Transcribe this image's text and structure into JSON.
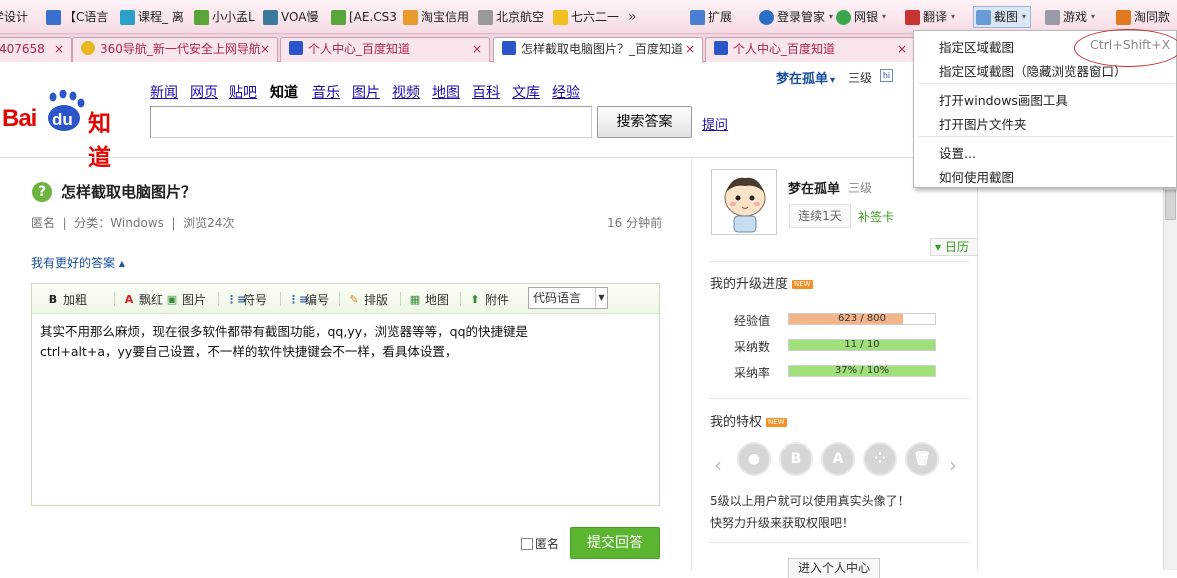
{
  "bookmarks": [
    {
      "label": "学设计",
      "color": "#e0608a"
    },
    {
      "label": "【C语言",
      "color": "#3b6fd0"
    },
    {
      "label": "课程_ 离",
      "color": "#2aa0c8"
    },
    {
      "label": "小小孟L",
      "color": "#5aa53a"
    },
    {
      "label": "VOA慢",
      "color": "#3b7a9a"
    },
    {
      "label": "[AE.CS3",
      "color": "#5aa53a"
    },
    {
      "label": "淘宝信用",
      "color": "#e89b2c"
    },
    {
      "label": "北京航空",
      "color": "#9a9a9a"
    },
    {
      "label": "七六二一",
      "color": "#f0c020"
    }
  ],
  "bookmarks_more": "»",
  "toolbar": {
    "extend": "扩展",
    "login": "登录管家",
    "bank": "网银",
    "translate": "翻译",
    "screenshot": "截图",
    "games": "游戏",
    "taotong": "淘同款"
  },
  "tabs": [
    {
      "label": "407658",
      "active": false
    },
    {
      "label": "360导航_新一代安全上网导航",
      "active": false
    },
    {
      "label": "个人中心_百度知道",
      "active": false
    },
    {
      "label": "怎样截取电脑图片？_百度知道",
      "active": true
    },
    {
      "label": "个人中心_百度知道",
      "active": false
    }
  ],
  "tab_close": "×",
  "header": {
    "logo_bai": "Bai",
    "logo_du": "du",
    "logo_zhidao": "知道",
    "nav": [
      "新闻",
      "网页",
      "贴吧",
      "知道",
      "音乐",
      "图片",
      "视频",
      "地图",
      "百科",
      "文库",
      "经验"
    ],
    "nav_current": "知道",
    "search_button": "搜索答案",
    "ask_link": "提问",
    "user": "梦在孤单",
    "user_caret": "▾",
    "user_level": "三级",
    "hi_icon": "hi"
  },
  "question": {
    "mark": "?",
    "title": "怎样截取电脑图片？",
    "meta": "匿名  |  分类：Windows  |  浏览24次",
    "time": "16 分钟前",
    "better_answer": "我有更好的答案 ▴"
  },
  "editor": {
    "tools": [
      {
        "icon": "B",
        "label": "加粗",
        "name": "bold"
      },
      {
        "icon": "A",
        "label": "飘红",
        "name": "red"
      },
      {
        "icon": "▣",
        "label": "图片",
        "name": "image"
      },
      {
        "icon": "⋮≡",
        "label": "符号",
        "name": "symbol"
      },
      {
        "icon": "⋮≡",
        "label": "编号",
        "name": "numbered"
      },
      {
        "icon": "✎",
        "label": "排版",
        "name": "format"
      },
      {
        "icon": "▦",
        "label": "地图",
        "name": "map"
      },
      {
        "icon": "⬆",
        "label": "附件",
        "name": "attach"
      }
    ],
    "code_language": "代码语言",
    "content": "其实不用那么麻烦，现在很多软件都带有截图功能，qq,yy，浏览器等等，qq的快捷键是\nctrl+alt+a，yy要自己设置，不一样的软件快捷键会不一样，看具体设置，"
  },
  "anonymous_label": "匿名",
  "submit_label": "提交回答",
  "sidebar": {
    "name": "梦在孤单",
    "level": "三级",
    "streak": "连续1天",
    "sign_card": "补签卡",
    "calendar": "▾ 日历",
    "progress_title": "我的升级进度",
    "new_badge": "NEW",
    "progress": [
      {
        "label": "经验值",
        "text": "623 / 800",
        "fraction": 0.779,
        "color": "#f4b48a"
      },
      {
        "label": "采纳数",
        "text": "11 / 10",
        "fraction": 1.0,
        "color": "#9fe07a"
      },
      {
        "label": "采纳率",
        "text": "37% / 10%",
        "fraction": 1.0,
        "color": "#9fe07a"
      }
    ],
    "privilege_title": "我的特权",
    "privileges": [
      {
        "icon": "avatar-icon",
        "glyph": "●"
      },
      {
        "icon": "b-icon",
        "glyph": "B"
      },
      {
        "icon": "a-icon",
        "glyph": "A"
      },
      {
        "icon": "group-icon",
        "glyph": "⁘"
      },
      {
        "icon": "trash-icon",
        "glyph": "🗑"
      }
    ],
    "prev_arrow": "‹",
    "next_arrow": "›",
    "privilege_text1": "5级以上用户就可以使用真实头像了！",
    "privilege_text2": "快努力升级来获取权限吧！",
    "enter_center": "进入个人中心"
  },
  "screenshot_menu": {
    "items": [
      "指定区域截图",
      "指定区域截图（隐藏浏览器窗口）",
      "打开windows画图工具",
      "打开图片文件夹",
      "设置...",
      "如何使用截图"
    ],
    "shortcut": "Ctrl+Shift+X"
  }
}
